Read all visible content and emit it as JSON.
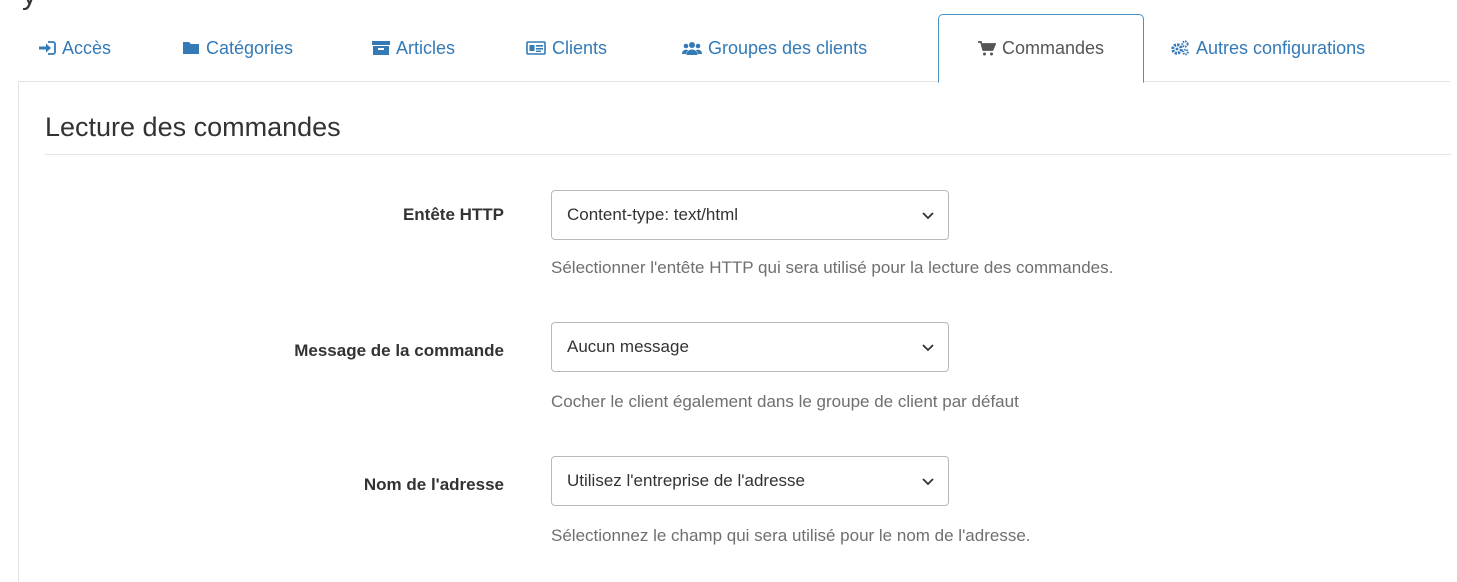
{
  "header": {
    "title_fragment": "y"
  },
  "tabs": [
    {
      "label": "Accès",
      "icon": "sign-in-icon"
    },
    {
      "label": "Catégories",
      "icon": "folder-icon"
    },
    {
      "label": "Articles",
      "icon": "archive-icon"
    },
    {
      "label": "Clients",
      "icon": "id-card-icon"
    },
    {
      "label": "Groupes des clients",
      "icon": "users-icon"
    },
    {
      "label": "Commandes",
      "icon": "cart-icon",
      "active": true
    },
    {
      "label": "Autres configurations",
      "icon": "cogs-icon"
    }
  ],
  "section": {
    "title": "Lecture des commandes"
  },
  "fields": [
    {
      "label": "Entête HTTP",
      "value": "Content-type: text/html",
      "help": "Sélectionner l'entête HTTP qui sera utilisé pour la lecture des commandes."
    },
    {
      "label": "Message de la commande",
      "value": "Aucun message",
      "help": "Cocher le client également dans le groupe de client par défaut"
    },
    {
      "label": "Nom de l'adresse",
      "value": "Utilisez l'entreprise de l'adresse",
      "help": "Sélectionnez le champ qui sera utilisé pour le nom de l'adresse."
    }
  ],
  "colors": {
    "link": "#337ab7",
    "active_tab_border": "#4a90c4",
    "help_text": "#6f6f6f"
  }
}
